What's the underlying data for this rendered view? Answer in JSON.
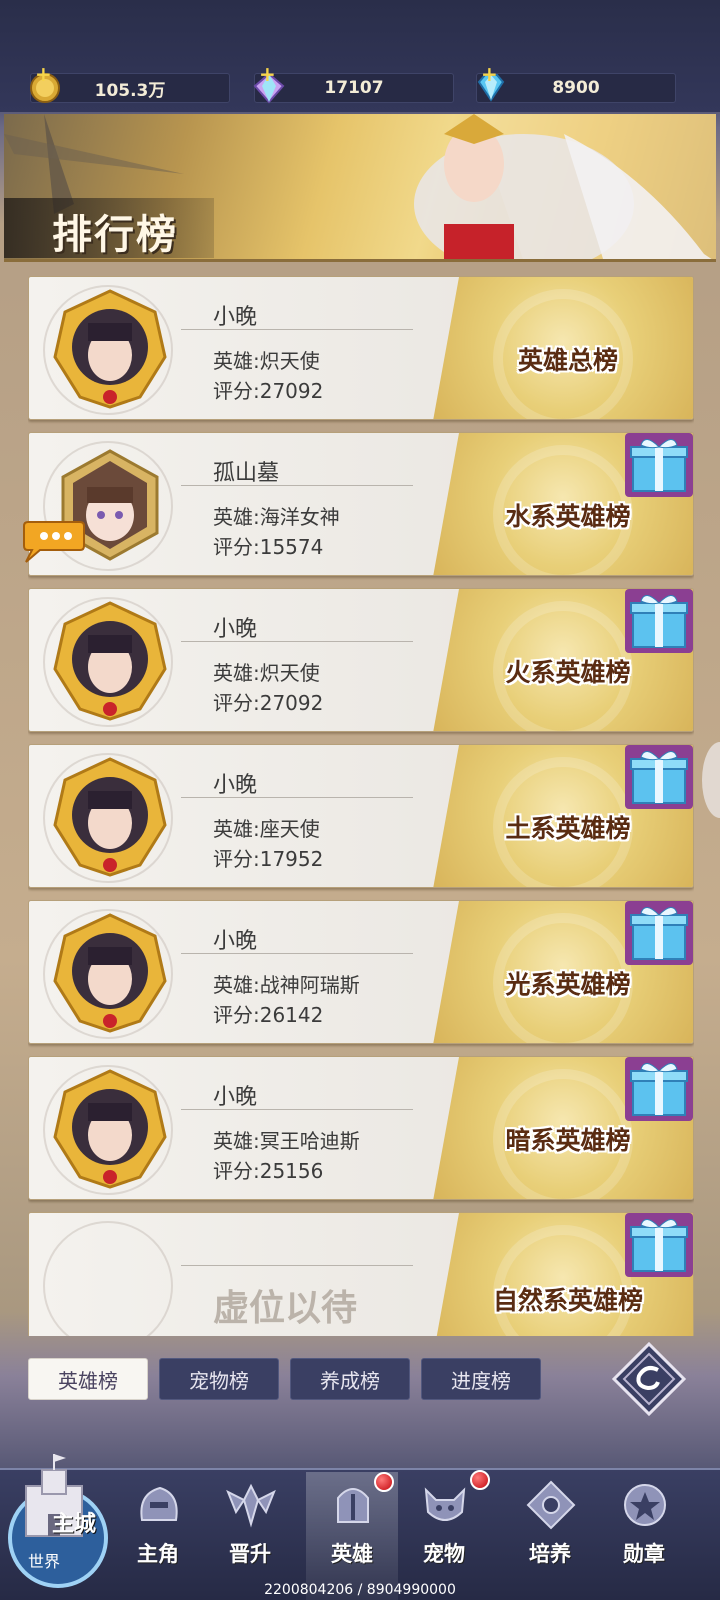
{
  "resources": [
    {
      "icon": "gold-coin-icon",
      "value": "105.3万"
    },
    {
      "icon": "rainbow-gem-icon",
      "value": "17107"
    },
    {
      "icon": "diamond-icon",
      "value": "8900"
    }
  ],
  "banner": {
    "title": "排行榜"
  },
  "cards": [
    {
      "name": "小晚",
      "hero": "英雄:炽天使",
      "score": "评分:27092",
      "rank_title": "英雄总榜",
      "gift": false,
      "chat": false,
      "avatar": "dark-hair-girl-avatar"
    },
    {
      "name": "孤山墓",
      "hero": "英雄:海洋女神",
      "score": "评分:15574",
      "rank_title": "水系英雄榜",
      "gift": true,
      "chat": true,
      "avatar": "brown-hair-girl-avatar"
    },
    {
      "name": "小晚",
      "hero": "英雄:炽天使",
      "score": "评分:27092",
      "rank_title": "火系英雄榜",
      "gift": true,
      "chat": false,
      "avatar": "dark-hair-girl-avatar"
    },
    {
      "name": "小晚",
      "hero": "英雄:座天使",
      "score": "评分:17952",
      "rank_title": "土系英雄榜",
      "gift": true,
      "chat": false,
      "avatar": "dark-hair-girl-avatar"
    },
    {
      "name": "小晚",
      "hero": "英雄:战神阿瑞斯",
      "score": "评分:26142",
      "rank_title": "光系英雄榜",
      "gift": true,
      "chat": false,
      "avatar": "dark-hair-girl-avatar"
    },
    {
      "name": "小晚",
      "hero": "英雄:冥王哈迪斯",
      "score": "评分:25156",
      "rank_title": "暗系英雄榜",
      "gift": true,
      "chat": false,
      "avatar": "dark-hair-girl-avatar"
    },
    {
      "empty_text": "虚位以待",
      "rank_title": "自然系英雄榜",
      "gift": true
    }
  ],
  "tabs": [
    {
      "label": "英雄榜",
      "active": true
    },
    {
      "label": "宠物榜",
      "active": false
    },
    {
      "label": "养成榜",
      "active": false
    },
    {
      "label": "进度榜",
      "active": false
    }
  ],
  "world_button": {
    "main": "主城",
    "sub": "世界"
  },
  "nav": [
    {
      "label": "主角",
      "icon": "hero-helmet-icon",
      "badge": false
    },
    {
      "label": "晋升",
      "icon": "promotion-wings-icon",
      "badge": false
    },
    {
      "label": "英雄",
      "icon": "knight-helmet-icon",
      "badge": true,
      "active": true
    },
    {
      "label": "宠物",
      "icon": "pet-beast-icon",
      "badge": true
    },
    {
      "label": "培养",
      "icon": "training-crest-icon",
      "badge": false
    },
    {
      "label": "勋章",
      "icon": "medal-star-icon",
      "badge": false
    }
  ],
  "footer": "2200804206 / 8904990000",
  "colors": {
    "rank_title": "#5a2c12",
    "tab_active_bg": "#f8f6f2",
    "tab_bg": "#3a3f63",
    "badge_red": "#c2060d"
  }
}
